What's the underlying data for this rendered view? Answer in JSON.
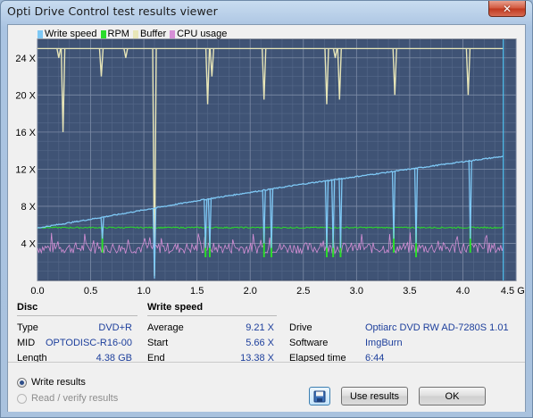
{
  "window": {
    "title": "Opti Drive Control test results viewer",
    "close_glyph": "✕"
  },
  "legend": [
    {
      "label": "Write speed",
      "color": "#7ec8f5"
    },
    {
      "label": "RPM",
      "color": "#2bdc2b"
    },
    {
      "label": "Buffer",
      "color": "#e8e6b8"
    },
    {
      "label": "CPU usage",
      "color": "#d68fd6"
    }
  ],
  "chart_data": {
    "type": "line",
    "x_unit": "GB",
    "x_ticks": [
      "0.0",
      "0.5",
      "1.0",
      "1.5",
      "2.0",
      "2.5",
      "3.0",
      "3.5",
      "4.0",
      "4.5 GB"
    ],
    "y_ticks": [
      "4 X",
      "8 X",
      "12 X",
      "16 X",
      "20 X",
      "24 X"
    ],
    "xlim": [
      0,
      4.5
    ],
    "ylim": [
      0,
      26
    ],
    "grid": true,
    "marker_x": 4.38,
    "series": [
      {
        "name": "Write speed",
        "color": "#7ec8f5",
        "x": [
          0.0,
          0.5,
          1.0,
          1.5,
          2.0,
          2.5,
          3.0,
          3.5,
          4.0,
          4.38
        ],
        "y": [
          5.66,
          6.6,
          7.6,
          8.6,
          9.5,
          10.4,
          11.2,
          12.0,
          12.8,
          13.38
        ],
        "dips": [
          {
            "x": 0.61,
            "y": 4.5
          },
          {
            "x": 1.1,
            "y": 0.2
          },
          {
            "x": 1.58,
            "y": 3.5
          },
          {
            "x": 1.62,
            "y": 3.5
          },
          {
            "x": 2.13,
            "y": 4.0
          },
          {
            "x": 2.2,
            "y": 3.5
          },
          {
            "x": 2.72,
            "y": 3.5
          },
          {
            "x": 2.78,
            "y": 3.5
          },
          {
            "x": 2.85,
            "y": 3.5
          },
          {
            "x": 3.35,
            "y": 4.5
          },
          {
            "x": 3.56,
            "y": 4.0
          },
          {
            "x": 4.07,
            "y": 4.5
          }
        ]
      },
      {
        "name": "RPM",
        "color": "#2bdc2b",
        "x": [
          0.0,
          4.38
        ],
        "y": [
          5.7,
          5.7
        ]
      },
      {
        "name": "Buffer",
        "color": "#e8e6b8",
        "x": [
          0.0,
          4.38
        ],
        "y": [
          25.0,
          25.0
        ],
        "dips": [
          {
            "x": 0.2,
            "y": 24.0
          },
          {
            "x": 0.24,
            "y": 16.0
          },
          {
            "x": 0.6,
            "y": 22.0
          },
          {
            "x": 0.83,
            "y": 24.0
          },
          {
            "x": 1.1,
            "y": 0.5
          },
          {
            "x": 1.6,
            "y": 19.0
          },
          {
            "x": 1.64,
            "y": 22.0
          },
          {
            "x": 2.13,
            "y": 19.5
          },
          {
            "x": 2.72,
            "y": 19.0
          },
          {
            "x": 2.8,
            "y": 24.0
          },
          {
            "x": 2.84,
            "y": 19.5
          },
          {
            "x": 3.36,
            "y": 20.0
          },
          {
            "x": 4.05,
            "y": 20.0
          }
        ]
      },
      {
        "name": "CPU usage",
        "color": "#d68fd6",
        "x": [
          0.0,
          4.38
        ],
        "y": [
          3.5,
          3.5
        ]
      }
    ]
  },
  "disc": {
    "header": "Disc",
    "type_label": "Type",
    "type_value": "DVD+R",
    "mid_label": "MID",
    "mid_value": "OPTODISC-R16-00",
    "length_label": "Length",
    "length_value": "4.38 GB"
  },
  "write_speed": {
    "header": "Write speed",
    "average_label": "Average",
    "average_value": "9.21 X",
    "start_label": "Start",
    "start_value": "5.66 X",
    "end_label": "End",
    "end_value": "13.38 X"
  },
  "drive_info": {
    "drive_label": "Drive",
    "drive_value": "Optiarc  DVD RW AD-7280S 1.01",
    "software_label": "Software",
    "software_value": "ImgBurn",
    "elapsed_label": "Elapsed time",
    "elapsed_value": "6:44"
  },
  "results": {
    "write_label": "Write results",
    "read_label": "Read / verify results"
  },
  "buttons": {
    "use_results": "Use results",
    "ok": "OK"
  }
}
